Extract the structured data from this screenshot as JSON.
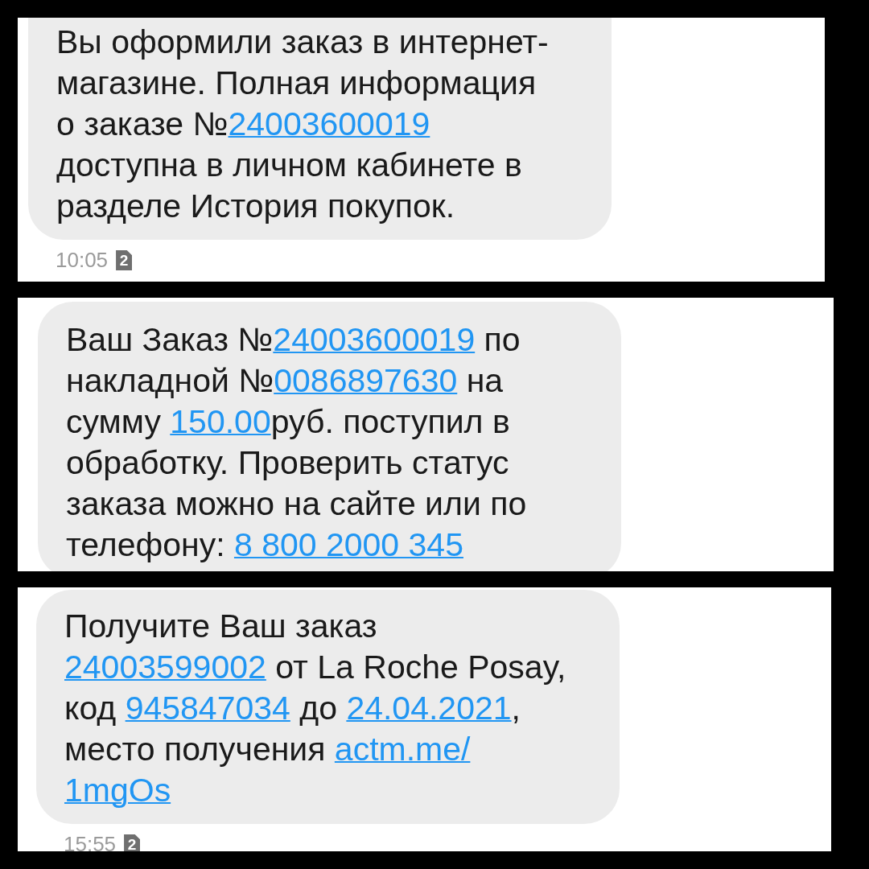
{
  "screenshots": [
    {
      "message": {
        "segments": [
          {
            "kind": "text",
            "text": "Вы оформили заказ в интернет-\nмагазине. Полная информация\nо заказе №"
          },
          {
            "kind": "link",
            "text": "24003600019"
          },
          {
            "kind": "text",
            "text": "\nдоступна в личном кабинете в\nразделе История покупок."
          }
        ]
      },
      "time": "10:05",
      "sim": "2"
    },
    {
      "message": {
        "segments": [
          {
            "kind": "text",
            "text": "Ваш Заказ №"
          },
          {
            "kind": "link",
            "text": "24003600019"
          },
          {
            "kind": "text",
            "text": " по\nнакладной №"
          },
          {
            "kind": "link",
            "text": "0086897630"
          },
          {
            "kind": "text",
            "text": " на\nсумму "
          },
          {
            "kind": "link",
            "text": "150.00"
          },
          {
            "kind": "text",
            "text": "руб. поступил в\nобработку. Проверить статус\nзаказа можно на сайте или по\nтелефону: "
          },
          {
            "kind": "link",
            "text": "8 800 2000 345"
          }
        ]
      }
    },
    {
      "message": {
        "segments": [
          {
            "kind": "text",
            "text": "Получите Ваш заказ\n"
          },
          {
            "kind": "link",
            "text": "24003599002"
          },
          {
            "kind": "text",
            "text": " от La Roche Posay,\nкод "
          },
          {
            "kind": "link",
            "text": "945847034"
          },
          {
            "kind": "text",
            "text": " до "
          },
          {
            "kind": "link",
            "text": "24.04.2021"
          },
          {
            "kind": "text",
            "text": ",\nместо получения "
          },
          {
            "kind": "link",
            "text": "actm.me/"
          },
          {
            "kind": "break"
          },
          {
            "kind": "link",
            "text": "1mgOs"
          }
        ]
      },
      "time": "15:55",
      "sim": "2"
    }
  ]
}
